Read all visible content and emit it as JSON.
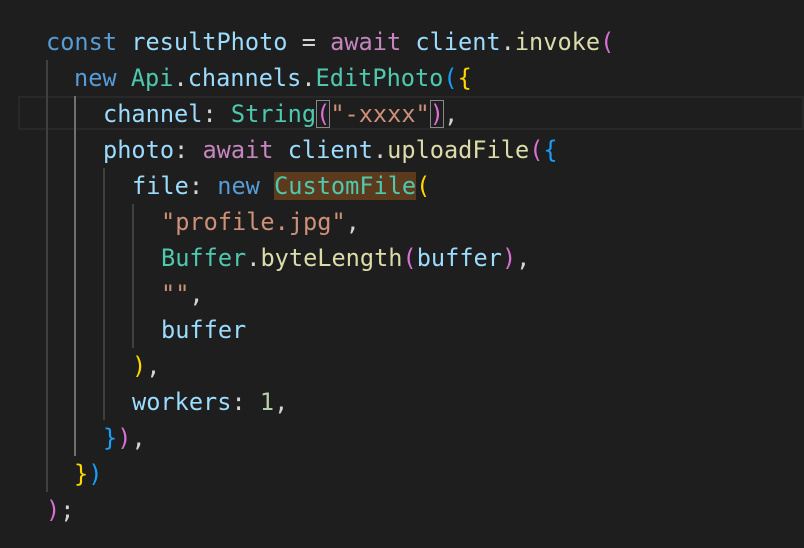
{
  "editor": {
    "theme": "dark",
    "background": "#1e1e1e",
    "colors": {
      "keyword": "#569cd6",
      "control_keyword": "#c586c0",
      "variable": "#9cdcfe",
      "type": "#4ec9b0",
      "function": "#dcdcaa",
      "string": "#ce9178",
      "number": "#b5cea8",
      "bracket_level_1": "#ffd700",
      "bracket_level_2": "#da70d6",
      "bracket_level_3": "#179fff"
    },
    "lines": [
      {
        "tokens": [
          "const",
          " ",
          "resultPhoto",
          " = ",
          "await",
          " ",
          "client",
          ".",
          "invoke",
          "("
        ]
      },
      {
        "tokens": [
          "new",
          " ",
          "Api",
          ".",
          "channels",
          ".",
          "EditPhoto",
          "(",
          "{"
        ]
      },
      {
        "tokens": [
          "channel",
          ": ",
          "String",
          "(",
          "\"-xxxx\"",
          ")",
          ","
        ]
      },
      {
        "tokens": [
          "photo",
          ": ",
          "await",
          " ",
          "client",
          ".",
          "uploadFile",
          "(",
          "{"
        ]
      },
      {
        "tokens": [
          "file",
          ": ",
          "new",
          " ",
          "CustomFile",
          "("
        ]
      },
      {
        "tokens": [
          "\"profile.jpg\"",
          ","
        ]
      },
      {
        "tokens": [
          "Buffer",
          ".",
          "byteLength",
          "(",
          "buffer",
          ")",
          ","
        ]
      },
      {
        "tokens": [
          "\"\"",
          ","
        ]
      },
      {
        "tokens": [
          "buffer"
        ]
      },
      {
        "tokens": [
          ")",
          ","
        ]
      },
      {
        "tokens": [
          "workers",
          ": ",
          "1",
          ","
        ]
      },
      {
        "tokens": [
          "}",
          ")",
          ","
        ]
      },
      {
        "tokens": [
          "}",
          ")"
        ]
      },
      {
        "tokens": [
          ")",
          ";"
        ]
      }
    ]
  }
}
